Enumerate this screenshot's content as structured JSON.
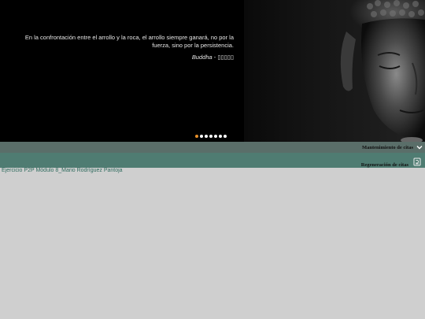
{
  "quote": {
    "text": "En la confrontación entre el arrollo y la roca, el arrollo siempre ganará, no por la fuerza, sino por la persistencia.",
    "author": "Buddha",
    "separator": " - ",
    "source": "▯▯▯▯▯"
  },
  "slider": {
    "dot_count": 7,
    "active_index": 0,
    "active_color": "#e8902a"
  },
  "menu": {
    "maintenance_label": "Mantenimiento de citas",
    "regeneration_label": "Regeneración de citas"
  },
  "footer": {
    "text": "Ejercicio P2P Módulo 8_Mario Rodríguez Pantoja"
  },
  "colors": {
    "bar_dark": "#5a6e69",
    "bar_teal": "#4f7c72",
    "page_bg": "#cfcfcf"
  }
}
